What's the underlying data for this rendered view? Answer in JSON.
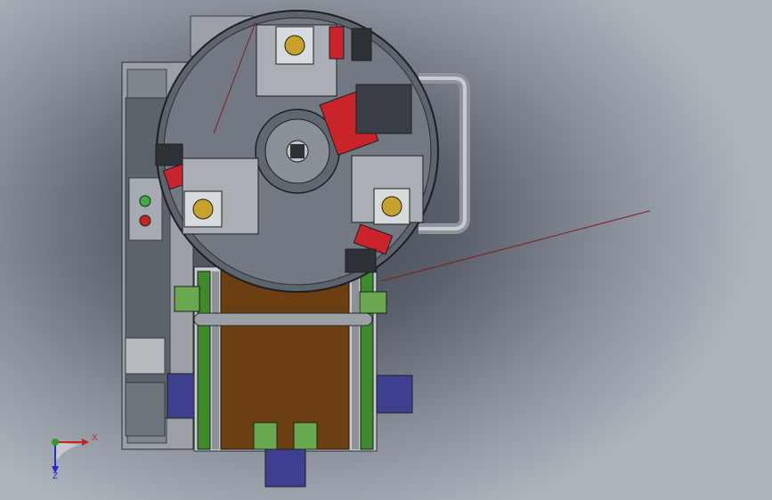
{
  "viewport": {
    "triad": {
      "x_label": "X",
      "z_label": "Z"
    }
  },
  "colors": {
    "background_center": "#3f4650",
    "background_edge": "#aeb4bc",
    "turntable": "#6d727b",
    "conveyor_belt": "#6b3f12",
    "conveyor_rail": "#3f8a2a",
    "clamp_red": "#c8242a",
    "bracket_blue": "#3f3f8f",
    "frame_gray": "#9aa0a6",
    "pipe": "#8e949a",
    "annotation_line": "#7a1e1e",
    "axis_x": "#cc1f1f",
    "axis_y": "#2aa02a",
    "axis_z": "#1f2fcc"
  },
  "icons": [
    "coordinate-triad-icon",
    "indicator-light-green-icon",
    "indicator-light-red-icon"
  ]
}
